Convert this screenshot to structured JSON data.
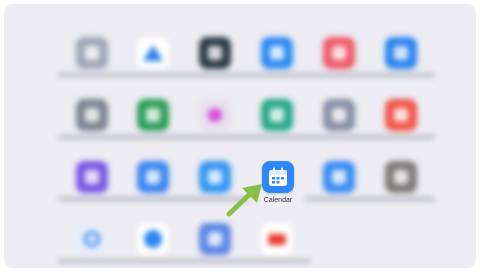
{
  "focused_app": {
    "label": "Calendar",
    "icon": "calendar-icon",
    "color": "#2f86f6"
  },
  "pointer": {
    "icon": "arrow-pointer-icon",
    "color": "#86c04a"
  },
  "blurred_apps": [
    {
      "icon": "app-icon",
      "color": "#9fa6b6"
    },
    {
      "icon": "app-icon",
      "color": "#2f7fe6"
    },
    {
      "icon": "app-icon",
      "color": "#2b3c46"
    },
    {
      "icon": "app-icon",
      "color": "#2c8bf2"
    },
    {
      "icon": "app-icon",
      "color": "#ee5a68"
    },
    {
      "icon": "app-icon",
      "color": "#2c84f0"
    },
    {
      "icon": "app-icon",
      "color": "#7e8492"
    },
    {
      "icon": "app-icon",
      "color": "#2e9e5a"
    },
    {
      "icon": "app-icon",
      "color": "#e6e0ec"
    },
    {
      "icon": "app-icon",
      "color": "#27a98a"
    },
    {
      "icon": "app-icon",
      "color": "#8890a4"
    },
    {
      "icon": "app-icon",
      "color": "#f0574a"
    },
    {
      "icon": "app-icon",
      "color": "#7a59e2"
    },
    {
      "icon": "app-icon",
      "color": "#3d86f2"
    },
    {
      "icon": "app-icon",
      "color": "#3495f2"
    },
    {
      "icon": "app-icon",
      "color": "#3a8cf2"
    },
    {
      "icon": "app-icon",
      "color": "#7d7b76"
    },
    {
      "icon": "app-icon",
      "color": "#e7ecf6"
    },
    {
      "icon": "app-icon",
      "color": "#2b86f0"
    },
    {
      "icon": "app-icon",
      "color": "#5b86e6"
    },
    {
      "icon": "app-icon",
      "color": "#ea3a2e"
    }
  ]
}
